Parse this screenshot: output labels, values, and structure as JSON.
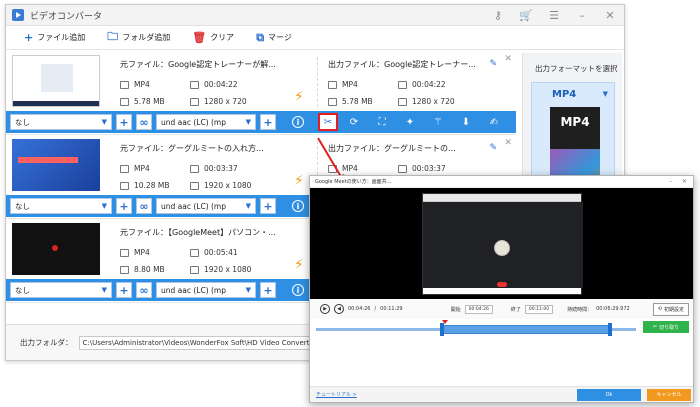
{
  "app": {
    "title": "ビデオコンバータ"
  },
  "toolbar": {
    "add_file": "ファイル追加",
    "add_folder": "フォルダ追加",
    "clear": "クリア",
    "merge": "マージ"
  },
  "tasks": [
    {
      "src_name": "元ファイル：Google認定トレーナーが解...",
      "dst_name": "出力ファイル：Google認定トレーナー...",
      "src_format": "MP4",
      "src_duration": "00:04:22",
      "src_size": "5.78 MB",
      "src_res": "1280 x 720",
      "dst_format": "MP4",
      "dst_duration": "00:04:22",
      "dst_size": "5.78 MB",
      "dst_res": "1280 x 720",
      "subtitle": "なし",
      "audio": "und aac (LC) (mp"
    },
    {
      "src_name": "元ファイル：グーグルミートの入れ方...",
      "dst_name": "出力ファイル：グーグルミートの...",
      "src_format": "MP4",
      "src_duration": "00:03:37",
      "src_size": "10.28 MB",
      "src_res": "1920 x 1080",
      "dst_format": "MP4",
      "dst_duration": "00:03:37",
      "dst_size": "",
      "dst_res": "",
      "subtitle": "なし",
      "audio": "und aac (LC) (mp"
    },
    {
      "src_name": "元ファイル：【GoogleMeet】パソコン・...",
      "dst_name": "",
      "src_format": "MP4",
      "src_duration": "00:05:41",
      "src_size": "8.80 MB",
      "src_res": "1920 x 1080",
      "dst_format": "",
      "dst_duration": "",
      "dst_size": "",
      "dst_res": "",
      "subtitle": "なし",
      "audio": "und aac (LC) (mp"
    }
  ],
  "side": {
    "title": "出力フォーマットを選択",
    "format": "MP4"
  },
  "footer": {
    "label": "出力フォルダ：",
    "path": "C:\\Users\\Administrator\\Videos\\WonderFox Soft\\HD Video Converter Factory Pro\\OutputVi"
  },
  "dialog": {
    "title": "Google Meetの使い方：画面共...",
    "time_current": "00:04:26",
    "time_total": "00:11:29",
    "start_label": "開始",
    "start_time": "00:04:26",
    "end_label": "終了",
    "end_time": "00:11:00",
    "duration_label": "持続時間：",
    "duration": "00:06:29.972",
    "reset": "初期設定",
    "split": "切り取り",
    "tutorial": "チュートリアル >",
    "ok": "Ok",
    "cancel": "キャンセル"
  },
  "colors": {
    "accent": "#2f8fe3",
    "highlight": "#e02020",
    "bolt": "#f29a1f",
    "split": "#2fb34b"
  }
}
